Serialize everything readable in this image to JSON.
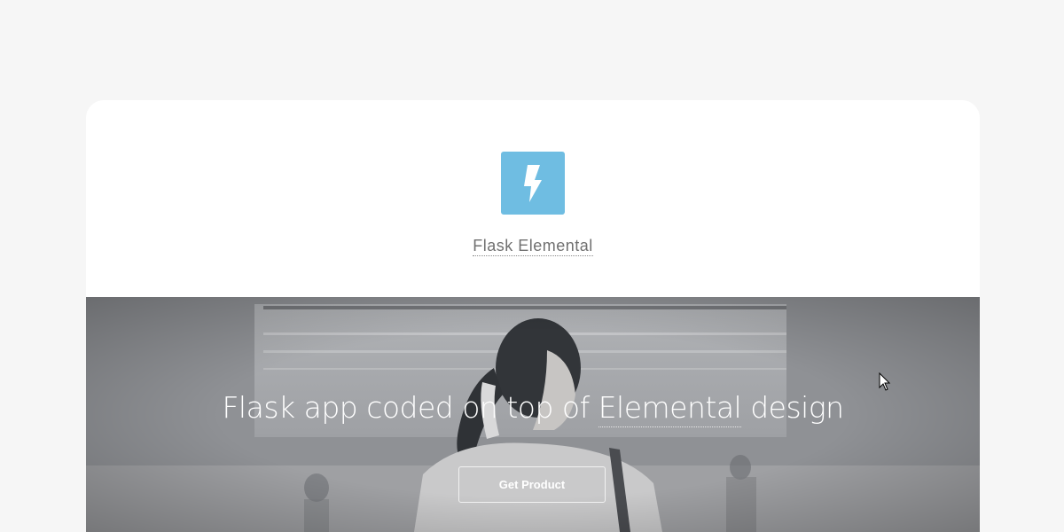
{
  "header": {
    "brand_label": "Flask Elemental",
    "logo_icon": "lightning-bolt-icon",
    "logo_color": "#6fbde2"
  },
  "hero": {
    "headline_prefix": "Flask app coded on top of ",
    "headline_link": "Elemental",
    "headline_suffix": " design",
    "cta_label": "Get Product"
  },
  "colors": {
    "page_background": "#f6f6f6",
    "card_background": "#ffffff",
    "hero_tint": "#9c9ea2"
  }
}
